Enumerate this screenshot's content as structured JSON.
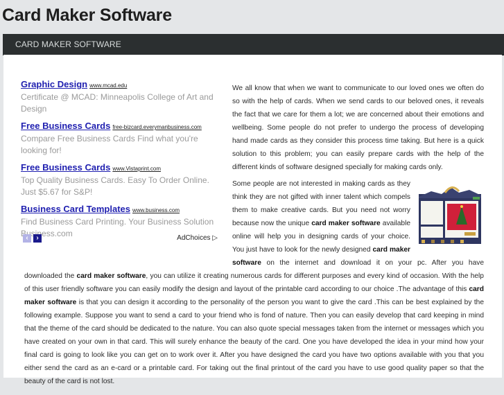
{
  "site": {
    "title": "Card Maker Software",
    "nav_item": "CARD MAKER SOFTWARE"
  },
  "ads": {
    "items": [
      {
        "title": "Graphic Design",
        "url": "www.mcad.edu",
        "desc": "Certificate @ MCAD: Minneapolis College of Art and Design"
      },
      {
        "title": "Free Business Cards",
        "url": "free-bizcard.everymanbusiness.com",
        "desc": "Compare Free Business Cards Find what you're looking for!"
      },
      {
        "title": "Free Business Cards",
        "url": "www.Vistaprint.com",
        "desc": "Top Quality Business Cards. Easy To Order Online. Just $5.67 for S&P!"
      },
      {
        "title": "Business Card Templates",
        "url": "www.business.com",
        "desc": "Find Business Card Printing. Your Business Solution Business.com"
      }
    ],
    "prev_icon": "‹",
    "next_icon": "›",
    "adchoices": "AdChoices ▷"
  },
  "article": {
    "p1": "We all know that when we want to communicate to our loved ones we often do so with the help of cards. When we send cards to our beloved ones, it reveals the fact that we care for them a lot; we are concerned about their emotions and wellbeing. Some people do not prefer to undergo the process of developing hand made cards as they consider this process time taking. But here is a quick solution to this problem; you can easily prepare cards with the help of the different kinds of software designed specially for making cards only.",
    "p2_a": "Some people are not interested in making cards as they think they are not gifted with inner talent which compels them to make creative cards. But you need not worry because now the unique ",
    "p2_b1": "card maker software",
    "p2_c": " available online will help you in designing cards of your choice. You just have to look for the newly designed ",
    "p2_b2": "card maker software",
    "p2_d": " on the internet and download it on your pc. After you have downloaded the ",
    "p2_b3": "card maker software",
    "p2_e": ", you can utilize it creating numerous cards for different purposes and every kind of occasion. With the help of this user friendly software you can easily modify the design and layout of the printable card according to our choice .The advantage of this ",
    "p2_b4": "card maker software",
    "p2_f": " is that you can design it according to the personality of the person you want to give the card .This can be best explained by the following example. Suppose you want to send a card to your friend who is fond of nature. Then you can easily develop that card keeping in mind that the theme of the card should be dedicated to the nature. You can also quote special messages taken from the internet or messages which you have created on your own in that card. This will surely enhance the beauty of the card. One you have developed the idea in your mind how your final card is going to look like you can get on to work over it. After you have designed the card you have two options available with you that you either send the card as an e-card or a printable card. For taking out the final printout of the card you have to use good quality paper so that the beauty of the card is not lost."
  }
}
